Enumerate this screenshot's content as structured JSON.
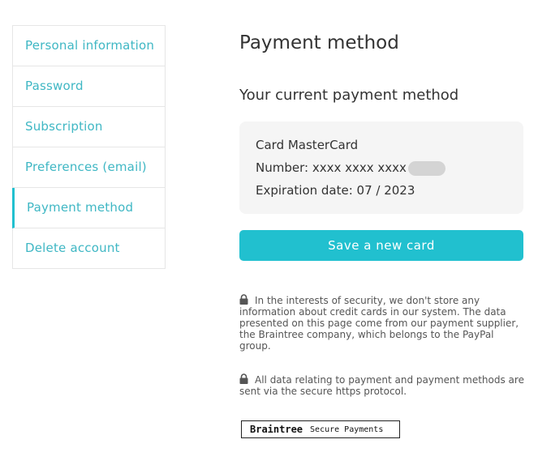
{
  "sidebar": {
    "items": [
      {
        "label": "Personal information"
      },
      {
        "label": "Password"
      },
      {
        "label": "Subscription"
      },
      {
        "label": "Preferences (email)"
      },
      {
        "label": "Payment method",
        "active": true
      },
      {
        "label": "Delete account"
      }
    ]
  },
  "main": {
    "title": "Payment method",
    "section_title": "Your current payment method",
    "card": {
      "type_line": "Card MasterCard",
      "number_line": "Number: xxxx xxxx xxxx",
      "number_masked": true,
      "expiration_line": "Expiration date: 07 / 2023"
    },
    "save_button": "Save a new card",
    "notes": [
      {
        "icon": "lock-icon",
        "text": "In the interests of security, we don't store any information about credit cards in our system. The data presented on this page come from our payment supplier, the Braintree company, which belongs to the PayPal group."
      },
      {
        "icon": "lock-icon",
        "text": "All data relating to payment and payment methods are sent via the secure https protocol."
      }
    ],
    "badge": {
      "brand": "Braintree",
      "tagline": "Secure Payments"
    }
  },
  "colors": {
    "accent": "#21c0cf",
    "link": "#3fb7c4",
    "card_bg": "#f5f5f5"
  }
}
